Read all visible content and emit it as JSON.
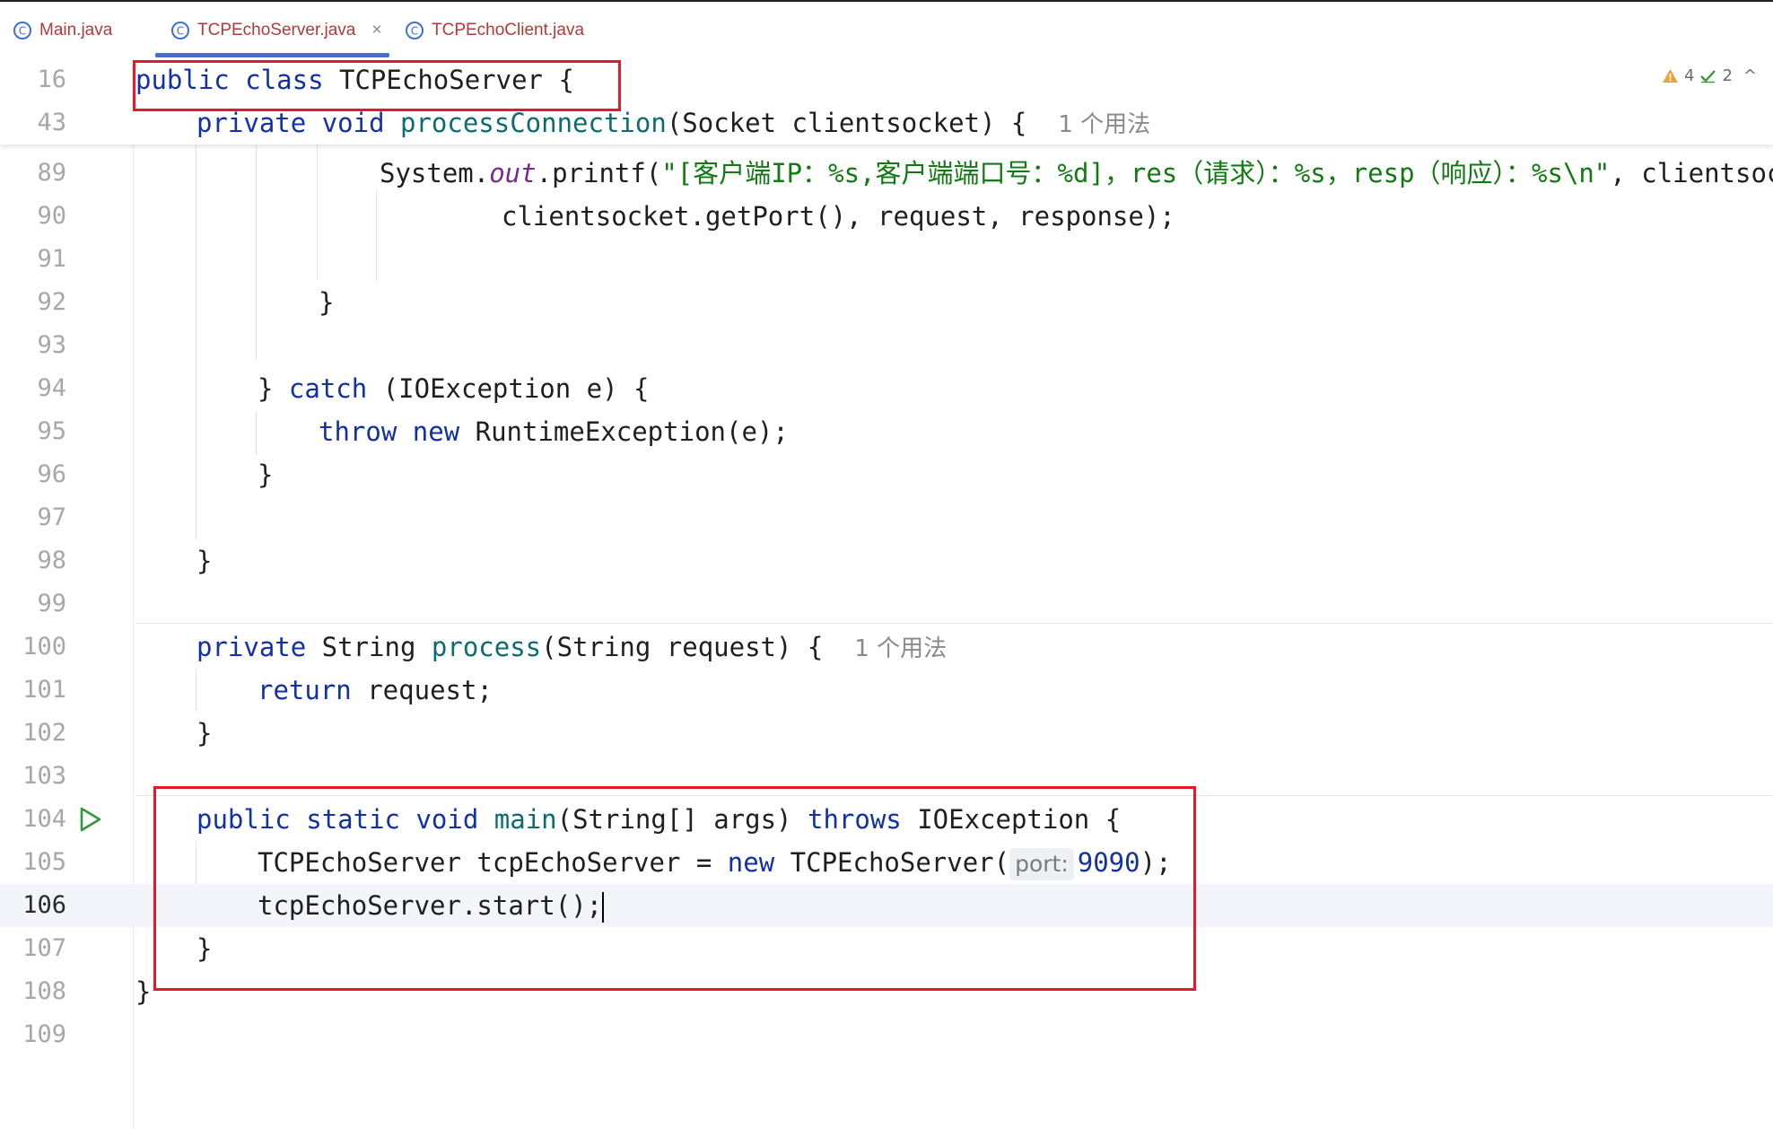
{
  "tabs": [
    {
      "label": "Main.java"
    },
    {
      "label": "TCPEchoServer.java",
      "active": true
    },
    {
      "label": "TCPEchoClient.java"
    }
  ],
  "tab_close_glyph": "×",
  "status": {
    "warnings": "4",
    "checks": "2",
    "collapse_glyph": "^"
  },
  "icons": [
    "java-class-icon",
    "close-icon",
    "warning-icon",
    "check-icon",
    "chevron-up-icon",
    "run-icon"
  ],
  "colors": {
    "keyword": "#1230a8",
    "function": "#0b6c73",
    "string": "#127a12",
    "highlight_box": "#e8172a",
    "active_tab_underline": "#3f6fd8"
  },
  "sticky": [
    {
      "line": "16",
      "code": {
        "k1": "public",
        "k2": "class",
        "t": "TCPEchoServer {"
      }
    },
    {
      "line": "43",
      "code": {
        "k1": "private",
        "k2": "void",
        "fn": "processConnection",
        "t": "(Socket clientsocket) {",
        "hint": "1 个用法"
      }
    }
  ],
  "lines": {
    "l89": {
      "n": "89",
      "a": "System.",
      "fld": "out",
      "b": ".printf(",
      "str": "\"[客户端IP：%s,客户端端口号：%d]，res（请求）：%s，resp（响应）：%s\\n\"",
      "c": ", clientsock"
    },
    "l90": {
      "n": "90",
      "t": "clientsocket.getPort(), request, response);"
    },
    "l91": {
      "n": "91"
    },
    "l92": {
      "n": "92",
      "t": "}"
    },
    "l93": {
      "n": "93"
    },
    "l94": {
      "n": "94",
      "a": "} ",
      "kw": "catch",
      "b": " (IOException e) {"
    },
    "l95": {
      "n": "95",
      "kw1": "throw",
      "kw2": "new",
      "b": " RuntimeException(e);"
    },
    "l96": {
      "n": "96",
      "t": "}"
    },
    "l97": {
      "n": "97"
    },
    "l98": {
      "n": "98",
      "t": "}"
    },
    "l99": {
      "n": "99"
    },
    "l100": {
      "n": "100",
      "kw1": "private",
      "a": " String ",
      "fn": "process",
      "b": "(String request) {",
      "hint": "1 个用法"
    },
    "l101": {
      "n": "101",
      "kw": "return",
      "b": " request;"
    },
    "l102": {
      "n": "102",
      "t": "}"
    },
    "l103": {
      "n": "103"
    },
    "l104": {
      "n": "104",
      "kw1": "public",
      "kw2": "static",
      "kw3": "void",
      "fn": "main",
      "a": "(String[] args) ",
      "kw4": "throws",
      "b": " IOException {"
    },
    "l105": {
      "n": "105",
      "a": "TCPEchoServer tcpEchoServer = ",
      "kw": "new",
      "b": " TCPEchoServer(",
      "inlay": "port:",
      "num": "9090",
      "c": ");"
    },
    "l106": {
      "n": "106",
      "t": "tcpEchoServer.start();"
    },
    "l107": {
      "n": "107",
      "t": "}"
    },
    "l108": {
      "n": "108",
      "t": "}"
    },
    "l109": {
      "n": "109"
    }
  }
}
